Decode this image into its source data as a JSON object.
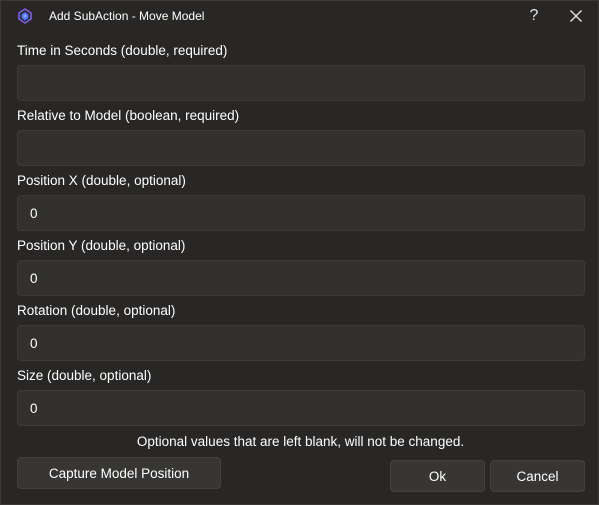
{
  "window": {
    "title": "Add SubAction - Move Model",
    "help_glyph": "?",
    "app_icon": "app-logo-icon",
    "close_icon": "close-icon"
  },
  "fields": [
    {
      "label": "Time in Seconds (double, required)",
      "value": "",
      "placeholder": ""
    },
    {
      "label": "Relative to Model (boolean, required)",
      "value": "",
      "placeholder": ""
    },
    {
      "label": "Position X (double, optional)",
      "value": "0",
      "placeholder": ""
    },
    {
      "label": "Position Y (double, optional)",
      "value": "0",
      "placeholder": ""
    },
    {
      "label": "Rotation (double, optional)",
      "value": "0",
      "placeholder": ""
    },
    {
      "label": "Size (double, optional)",
      "value": "0",
      "placeholder": ""
    }
  ],
  "note": "Optional values that are left blank, will not be changed.",
  "buttons": {
    "capture": "Capture Model Position",
    "ok": "Ok",
    "cancel": "Cancel"
  },
  "colors": {
    "background": "#282726",
    "input_bg": "#32312f",
    "button_bg": "#373634",
    "icon_accent_blue": "#3b82f6",
    "icon_accent_purple": "#a855f7"
  }
}
